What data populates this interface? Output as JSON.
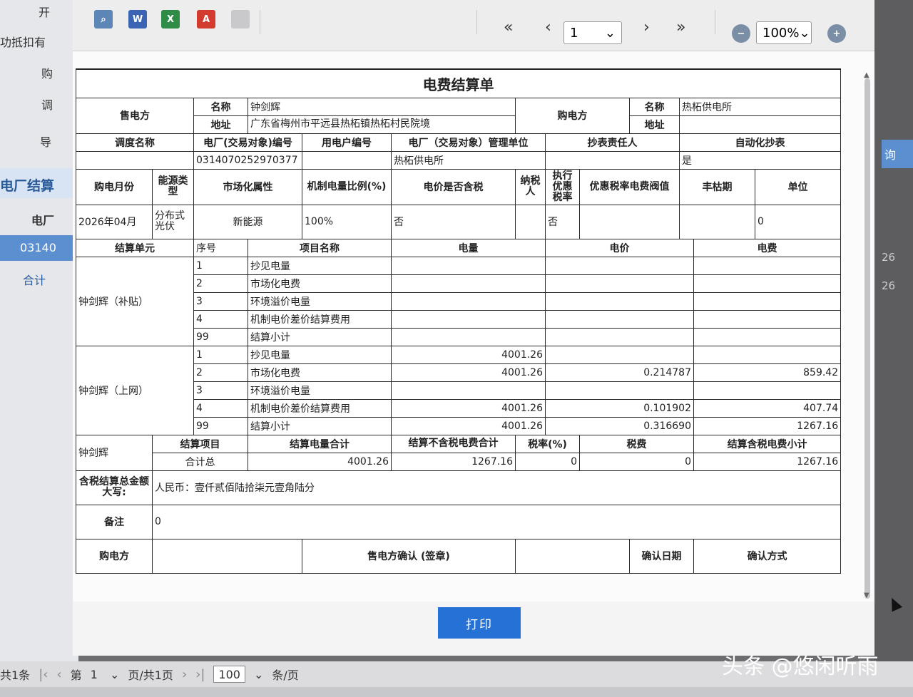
{
  "background_app": {
    "side_texts": [
      "开",
      "功抵扣有",
      "购",
      "调",
      "导"
    ],
    "section_title": "电厂结算",
    "column_header": "电厂",
    "selected_row": "03140",
    "total_label": "合计",
    "right_button": "询",
    "right_values": [
      "26",
      "26"
    ]
  },
  "pager": {
    "total": "共1条",
    "page_prefix": "第",
    "page_value": "1",
    "page_suffix": "页/共1页",
    "size_value": "100",
    "size_suffix": "条/页"
  },
  "toolbar": {
    "icons": [
      "search-doc-icon",
      "word-icon",
      "excel-icon",
      "pdf-icon",
      "blank-doc-icon"
    ],
    "first": "«",
    "prev": "‹",
    "page": "1",
    "next": "›",
    "last": "»",
    "zoom": "100%"
  },
  "bill": {
    "title": "电费结算单",
    "seller_label": "售电方",
    "name_label": "名称",
    "seller_name": "钟剑辉",
    "address_label": "地址",
    "seller_address": "广东省梅州市平远县热柘镇热柘村民院境",
    "buyer_label": "购电方",
    "buyer_name_label": "名称",
    "buyer_name": "热柘供电所",
    "buyer_address_label": "地址",
    "dispatch_name": "调度名称",
    "plant_code_label": "电厂(交易对象)编号",
    "user_code_label": "用电户编号",
    "mgmt_unit_label": "电厂（交易对象）管理单位",
    "meter_reader_label": "抄表责任人",
    "auto_meter_label": "自动化抄表",
    "plant_code": "0314070252970377",
    "mgmt_unit": "热柘供电所",
    "auto_meter": "是",
    "h_month": "购电月份",
    "h_energy_type": "能源类型",
    "h_market": "市场化属性",
    "h_ratio": "机制电量比例(%)",
    "h_tax_incl": "电价是否含税",
    "h_taxpayer": "纳税人",
    "h_pref_rate": "执行优惠税率",
    "h_threshold": "优惠税率电费阀值",
    "h_season": "丰枯期",
    "h_unit": "单位",
    "v_month": "2026年04月",
    "v_energy_type": "分布式光伏",
    "v_market": "新能源",
    "v_ratio": "100%",
    "v_tax_incl": "否",
    "v_pref_rate": "否",
    "v_unit": "0",
    "h_settle_unit": "结算单元",
    "h_seq": "序号",
    "h_item": "项目名称",
    "h_energy": "电量",
    "h_price": "电价",
    "h_fee": "电费",
    "group1": "钟剑辉（补贴）",
    "group2": "钟剑辉（上网）",
    "items": [
      {
        "seq": "1",
        "name": "抄见电量"
      },
      {
        "seq": "2",
        "name": "市场化电费"
      },
      {
        "seq": "3",
        "name": "环境溢价电量"
      },
      {
        "seq": "4",
        "name": "机制电价差价结算费用"
      },
      {
        "seq": "99",
        "name": "结算小计"
      }
    ],
    "group2_rows": [
      {
        "energy": "4001.26",
        "price": "",
        "fee": ""
      },
      {
        "energy": "4001.26",
        "price": "0.214787",
        "fee": "859.42"
      },
      {
        "energy": "",
        "price": "",
        "fee": ""
      },
      {
        "energy": "4001.26",
        "price": "0.101902",
        "fee": "407.74"
      },
      {
        "energy": "4001.26",
        "price": "0.316690",
        "fee": "1267.16"
      }
    ],
    "sum_owner": "钟剑辉",
    "sh_item": "结算项目",
    "sh_energy": "结算电量合计",
    "sh_fee_ex": "结算不含税电费合计",
    "sh_rate": "税率(%)",
    "sh_tax": "税费",
    "sh_total": "结算含税电费小计",
    "sv_item": "合计总",
    "sv_energy": "4001.26",
    "sv_fee_ex": "1267.16",
    "sv_rate": "0",
    "sv_tax": "0",
    "sv_total": "1267.16",
    "amount_label": "含税结算总金额大写:",
    "amount_text": "人民币：壹仟贰佰陆拾柒元壹角陆分",
    "remark_label": "备注",
    "remark_value": "0",
    "sign_buyer": "购电方",
    "sign_seller": "售电方确认 (签章)",
    "confirm_date": "确认日期",
    "confirm_method": "确认方式"
  },
  "print_button": "打印",
  "watermark": "头条 @悠闲听雨"
}
